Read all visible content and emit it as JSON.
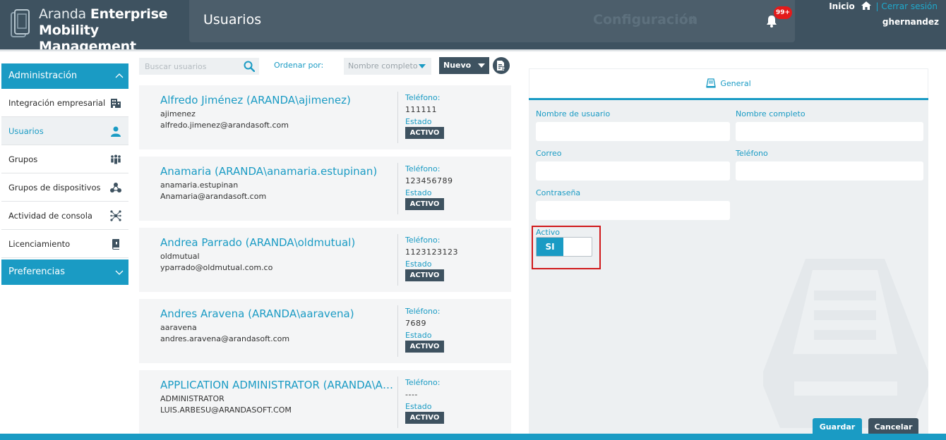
{
  "brand": {
    "name_light": "Aranda",
    "name_bold_1": "Enterprise",
    "name_bold_2": "Mobility Management"
  },
  "header": {
    "page_title": "Usuarios",
    "config_label": "Configuración",
    "notifications_badge": "99+",
    "home_link": "Inicio",
    "separator": "|",
    "logout_link": "Cerrar sesión",
    "username": "ghernandez"
  },
  "sidebar": {
    "section_admin": "Administración",
    "items": [
      {
        "label": "Integración empresarial",
        "icon": "building-icon"
      },
      {
        "label": "Usuarios",
        "icon": "user-icon",
        "active": true
      },
      {
        "label": "Grupos",
        "icon": "group-icon"
      },
      {
        "label": "Grupos de dispositivos",
        "icon": "device-groups-icon"
      },
      {
        "label": "Actividad de consola",
        "icon": "network-icon"
      },
      {
        "label": "Licenciamiento",
        "icon": "book-icon"
      }
    ],
    "section_prefs": "Preferencias"
  },
  "toolbar": {
    "search_placeholder": "Buscar usuarios",
    "sort_label": "Ordenar por:",
    "sort_value": "Nombre completo",
    "new_label": "Nuevo"
  },
  "users": [
    {
      "name": "Alfredo Jiménez (ARANDA\\ajimenez)",
      "login": "ajimenez",
      "email": "alfredo.jimenez@arandasoft.com",
      "phone_label": "Teléfono:",
      "phone": "111111",
      "state_label": "Estado",
      "state": "ACTIVO"
    },
    {
      "name": "Anamaria (ARANDA\\anamaria.estupinan)",
      "login": "anamaria.estupinan",
      "email": "Anamaria@arandasoft.com",
      "phone_label": "Teléfono:",
      "phone": "123456789",
      "state_label": "Estado",
      "state": "ACTIVO"
    },
    {
      "name": "Andrea Parrado (ARANDA\\oldmutual)",
      "login": "oldmutual",
      "email": "yparrado@oldmutual.com.co",
      "phone_label": "Teléfono:",
      "phone": "1123123123",
      "state_label": "Estado",
      "state": "ACTIVO"
    },
    {
      "name": "Andres Aravena (ARANDA\\aaravena)",
      "login": "aaravena",
      "email": "andres.aravena@arandasoft.com",
      "phone_label": "Teléfono:",
      "phone": "7689",
      "state_label": "Estado",
      "state": "ACTIVO"
    },
    {
      "name": "APPLICATION ADMINISTRATOR (ARANDA\\AD...",
      "login": "ADMINISTRATOR",
      "email": "LUIS.ARBESU@ARANDASOFT.COM",
      "phone_label": "Teléfono:",
      "phone": "----",
      "state_label": "Estado",
      "state": "ACTIVO"
    }
  ],
  "detail": {
    "tab_general": "General",
    "username_label": "Nombre de usuario",
    "username_value": "",
    "fullname_label": "Nombre completo",
    "fullname_value": "",
    "email_label": "Correo",
    "email_value": "",
    "phone_label": "Teléfono",
    "phone_value": "",
    "password_label": "Contraseña",
    "password_value": "",
    "active_label": "Activo",
    "active_toggle": "SI",
    "save_label": "Guardar",
    "cancel_label": "Cancelar"
  },
  "colors": {
    "accent": "#1a9bc4",
    "dark": "#3e5260",
    "highlight": "#d0191b",
    "badge": "#e31b1b"
  }
}
